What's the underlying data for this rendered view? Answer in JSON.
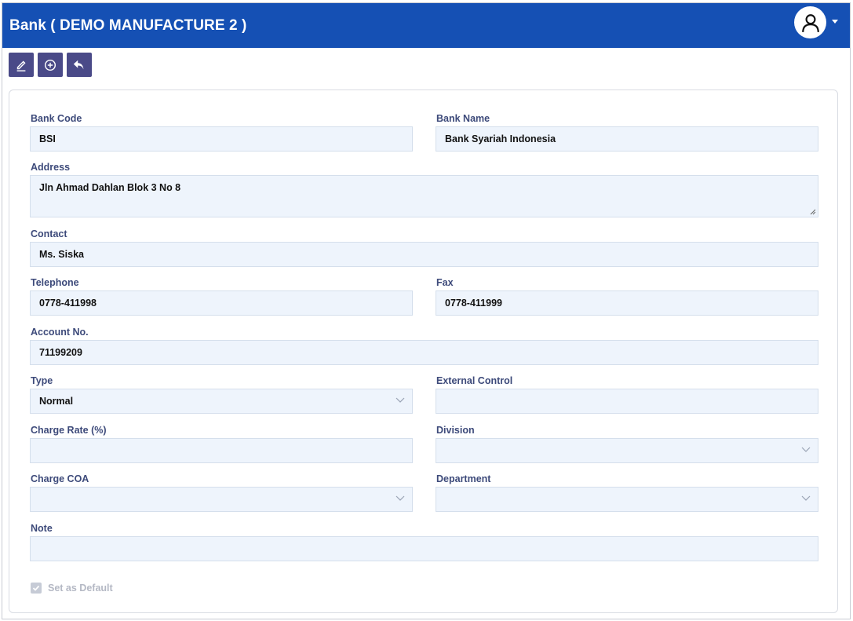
{
  "header": {
    "title": "Bank ( DEMO MANUFACTURE 2 )",
    "color": "#1550b4"
  },
  "toolbar": {
    "buttons": [
      "edit-icon",
      "add-circle-icon",
      "undo-icon"
    ],
    "color": "#4a4a88"
  },
  "form": {
    "bank_code": {
      "label": "Bank Code",
      "value": "BSI"
    },
    "bank_name": {
      "label": "Bank Name",
      "value": "Bank Syariah Indonesia"
    },
    "address": {
      "label": "Address",
      "value": "Jln Ahmad Dahlan Blok 3 No 8"
    },
    "contact": {
      "label": "Contact",
      "value": "Ms. Siska"
    },
    "telephone": {
      "label": "Telephone",
      "value": "0778-411998"
    },
    "fax": {
      "label": "Fax",
      "value": "0778-411999"
    },
    "account_no": {
      "label": "Account No.",
      "value": "71199209"
    },
    "type": {
      "label": "Type",
      "value": "Normal"
    },
    "external_control": {
      "label": "External Control",
      "value": ""
    },
    "charge_rate": {
      "label": "Charge Rate (%)",
      "value": ""
    },
    "division": {
      "label": "Division",
      "value": ""
    },
    "charge_coa": {
      "label": "Charge COA",
      "value": ""
    },
    "department": {
      "label": "Department",
      "value": ""
    },
    "note": {
      "label": "Note",
      "value": ""
    },
    "set_as_default": {
      "label": "Set as Default",
      "checked": true
    }
  }
}
